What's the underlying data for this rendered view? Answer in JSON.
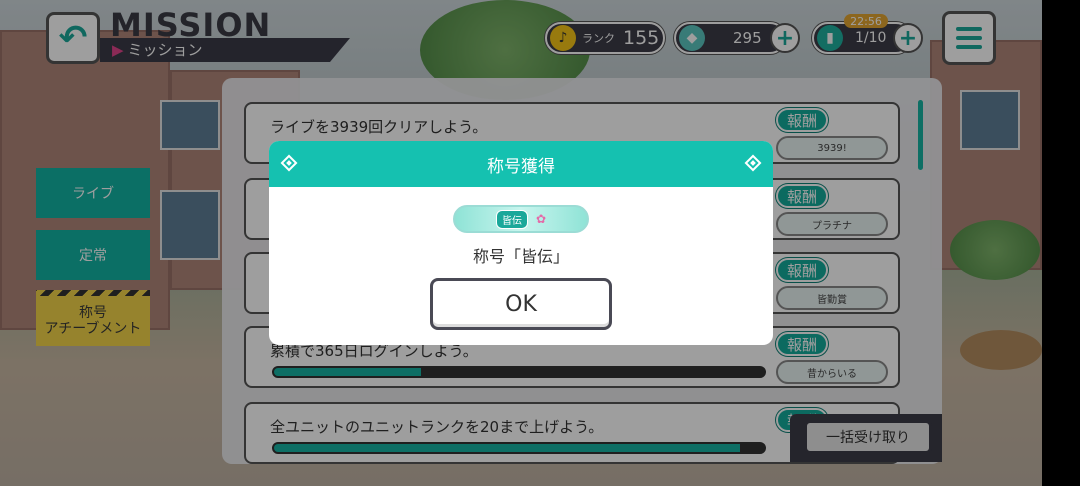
{
  "header": {
    "title": "MISSION",
    "subtitle": "ミッション",
    "rank_label": "ランク",
    "rank_value": "155",
    "gems_value": "295",
    "tickets_value": "1/10",
    "timer": "22:56"
  },
  "nav": {
    "items": [
      {
        "label": "ライブ"
      },
      {
        "label": "定常"
      },
      {
        "label": "称号\nアチーブメント"
      }
    ]
  },
  "missions": [
    {
      "text": "ライブを3939回クリアしよう。",
      "reward_label": "報酬",
      "reward_item": "3939!",
      "progress": null
    },
    {
      "text": "",
      "reward_label": "報酬",
      "reward_item": "プラチナ",
      "progress": null
    },
    {
      "text": "",
      "reward_label": "報酬",
      "reward_item": "皆勤賞",
      "progress": null
    },
    {
      "text": "累積で365日ログインしよう。",
      "reward_label": "報酬",
      "reward_item": "昔からいる",
      "progress": 0.3
    },
    {
      "text": "全ユニットのユニットランクを20まで上げよう。",
      "reward_label": "報酬",
      "reward_item": "",
      "progress": 0.95
    }
  ],
  "bulk_button": "一括受け取り",
  "modal": {
    "title": "称号獲得",
    "badge_tag": "皆伝",
    "title_name": "称号「皆伝」",
    "ok_label": "OK"
  },
  "colors": {
    "accent": "#15c1b0",
    "dark": "#3c3c48",
    "nav_highlight": "#f3d449"
  }
}
